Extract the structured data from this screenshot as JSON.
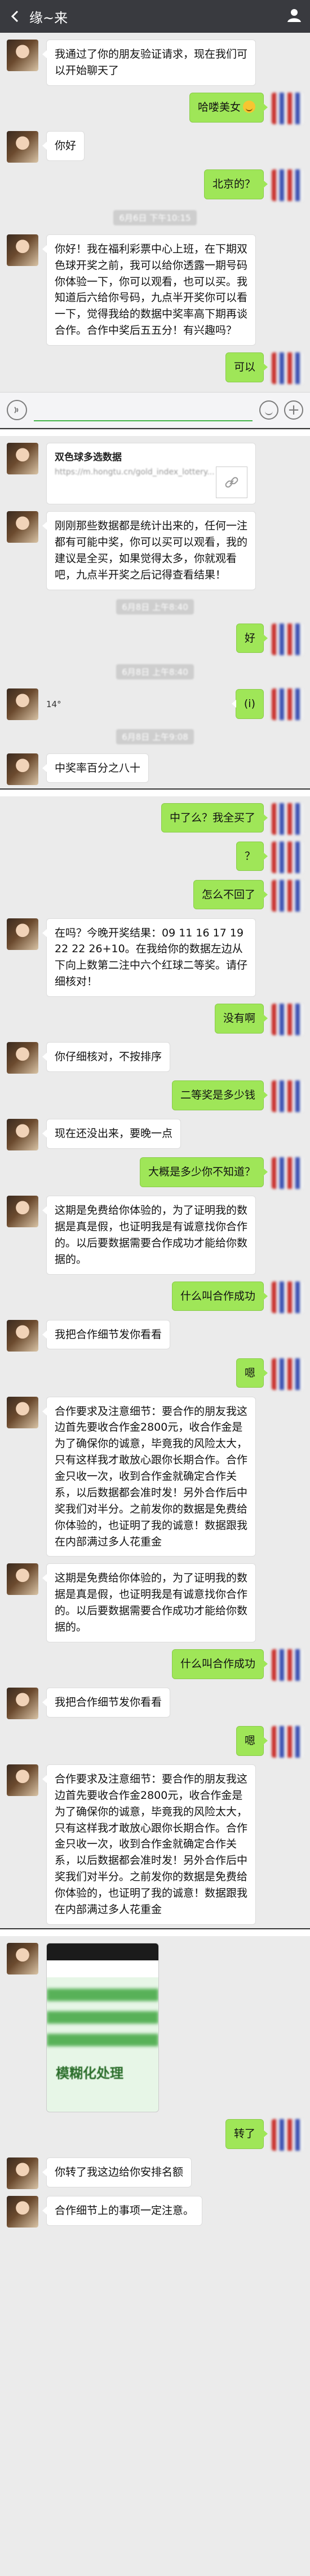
{
  "header": {
    "title": "缘~来"
  },
  "messages": [
    {
      "side": "left",
      "text": "我通过了你的朋友验证请求，现在我们可以开始聊天了"
    },
    {
      "side": "right",
      "text": "哈喽美女"
    },
    {
      "side": "left",
      "text": "你好"
    },
    {
      "side": "right",
      "text": "北京的？"
    },
    {
      "timestamp": "6月6日 下午10:15"
    },
    {
      "side": "left",
      "text": "你好！我在福利彩票中心上班，在下期双色球开奖之前，我可以给你透露一期号码你体验一下，你可以观看，也可以买。我知道后六给你号码，九点半开奖你可以看一下，觉得我给的数据中奖率高下期再谈合作。合作中奖后五五分！有兴趣吗？"
    },
    {
      "side": "right",
      "text": "可以"
    }
  ],
  "section2": {
    "link_title": "双色球多选数据",
    "link_desc": "https://m.hongtu.cn/gold_index_lottery...",
    "msg_a": "刚刚那些数据都是统计出来的，任何一注都有可能中奖，你可以买可以观看，我的建议是全买，如果觉得太多，你就观看吧，九点半开奖之后记得查看结果！",
    "ts_a": "6月8日 上午8:40",
    "msg_b": "好",
    "ts_b": "6月8日 上午8:40",
    "tiny_left": "14°",
    "tiny_right": "(i)",
    "ts_c": "6月8日 上午9:08",
    "msg_c": "中奖率百分之八十"
  },
  "section3": {
    "msgs": [
      {
        "side": "right",
        "text": "中了么？我全买了"
      },
      {
        "side": "right",
        "text": "？"
      },
      {
        "side": "right",
        "text": "怎么不回了"
      },
      {
        "side": "left",
        "text": "在吗？今晚开奖结果：09 11 16 17 19 22 22 26+10。在我给你的数据左边从下向上数第二注中六个红球二等奖。请仔细核对！"
      },
      {
        "side": "right",
        "text": "没有啊"
      },
      {
        "side": "left",
        "text": "你仔细核对，不按排序"
      },
      {
        "side": "right",
        "text": "二等奖是多少钱"
      },
      {
        "side": "left",
        "text": "现在还没出来，要晚一点"
      },
      {
        "side": "right",
        "text": "大概是多少你不知道？"
      },
      {
        "side": "left",
        "text": "这期是免费给你体验的，为了证明我的数据是真是假，也证明我是有诚意找你合作的。以后要数据需要合作成功才能给你数据的。"
      },
      {
        "side": "right",
        "text": "什么叫合作成功"
      },
      {
        "side": "left",
        "text": "我把合作细节发你看看"
      },
      {
        "side": "right",
        "text": "嗯"
      },
      {
        "side": "left",
        "text": "合作要求及注意细节：要合作的朋友我这边首先要收合作金2800元，收合作金是为了确保你的诚意，毕竟我的风险太大，只有这样我才敢放心跟你长期合作。合作金只收一次，收到合作金就确定合作关系，以后数据都会准时发！另外合作后中奖我们对半分。之前发你的数据是免费给你体验的，也证明了我的诚意！数据跟我在内部满过多人花重金"
      },
      {
        "side": "left",
        "text": "这期是免费给你体验的，为了证明我的数据是真是假，也证明我是有诚意找你合作的。以后要数据需要合作成功才能给你数据的。"
      },
      {
        "side": "right",
        "text": "什么叫合作成功"
      },
      {
        "side": "left",
        "text": "我把合作细节发你看看"
      },
      {
        "side": "right",
        "text": "嗯"
      },
      {
        "side": "left",
        "text": "合作要求及注意细节：要合作的朋友我这边首先要收合作金2800元，收合作金是为了确保你的诚意，毕竟我的风险太大，只有这样我才敢放心跟你长期合作。合作金只收一次，收到合作金就确定合作关系，以后数据都会准时发！另外合作后中奖我们对半分。之前发你的数据是免费给你体验的，也证明了我的诚意！数据跟我在内部满过多人花重金"
      }
    ]
  },
  "section4": {
    "image_caption": "模糊化处理",
    "msg_right": "转了",
    "msg_left_1": "你转了我这边给你安排名额",
    "msg_left_2": "合作细节上的事项一定注意。"
  }
}
